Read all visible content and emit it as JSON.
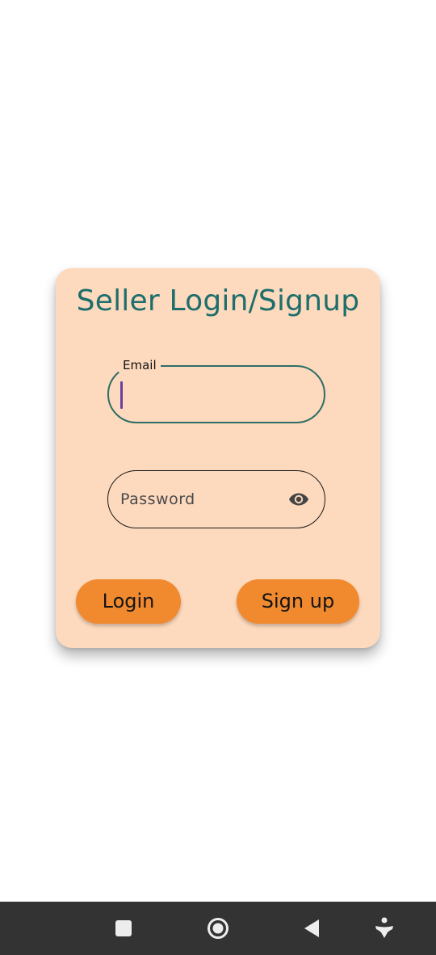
{
  "card": {
    "title": "Seller Login/Signup"
  },
  "email": {
    "label": "Email",
    "value": ""
  },
  "password": {
    "placeholder": "Password",
    "toggle_icon": "eye-icon"
  },
  "buttons": {
    "login": "Login",
    "signup": "Sign up"
  },
  "navigation": {
    "items": [
      "recents-square-icon",
      "home-circle-icon",
      "back-triangle-icon",
      "accessibility-icon"
    ]
  },
  "colors": {
    "card_bg": "#fdd9bd",
    "title": "#1d6e6c",
    "button": "#f18a2f",
    "email_outline": "#2d6e66",
    "navbar": "#333333"
  }
}
